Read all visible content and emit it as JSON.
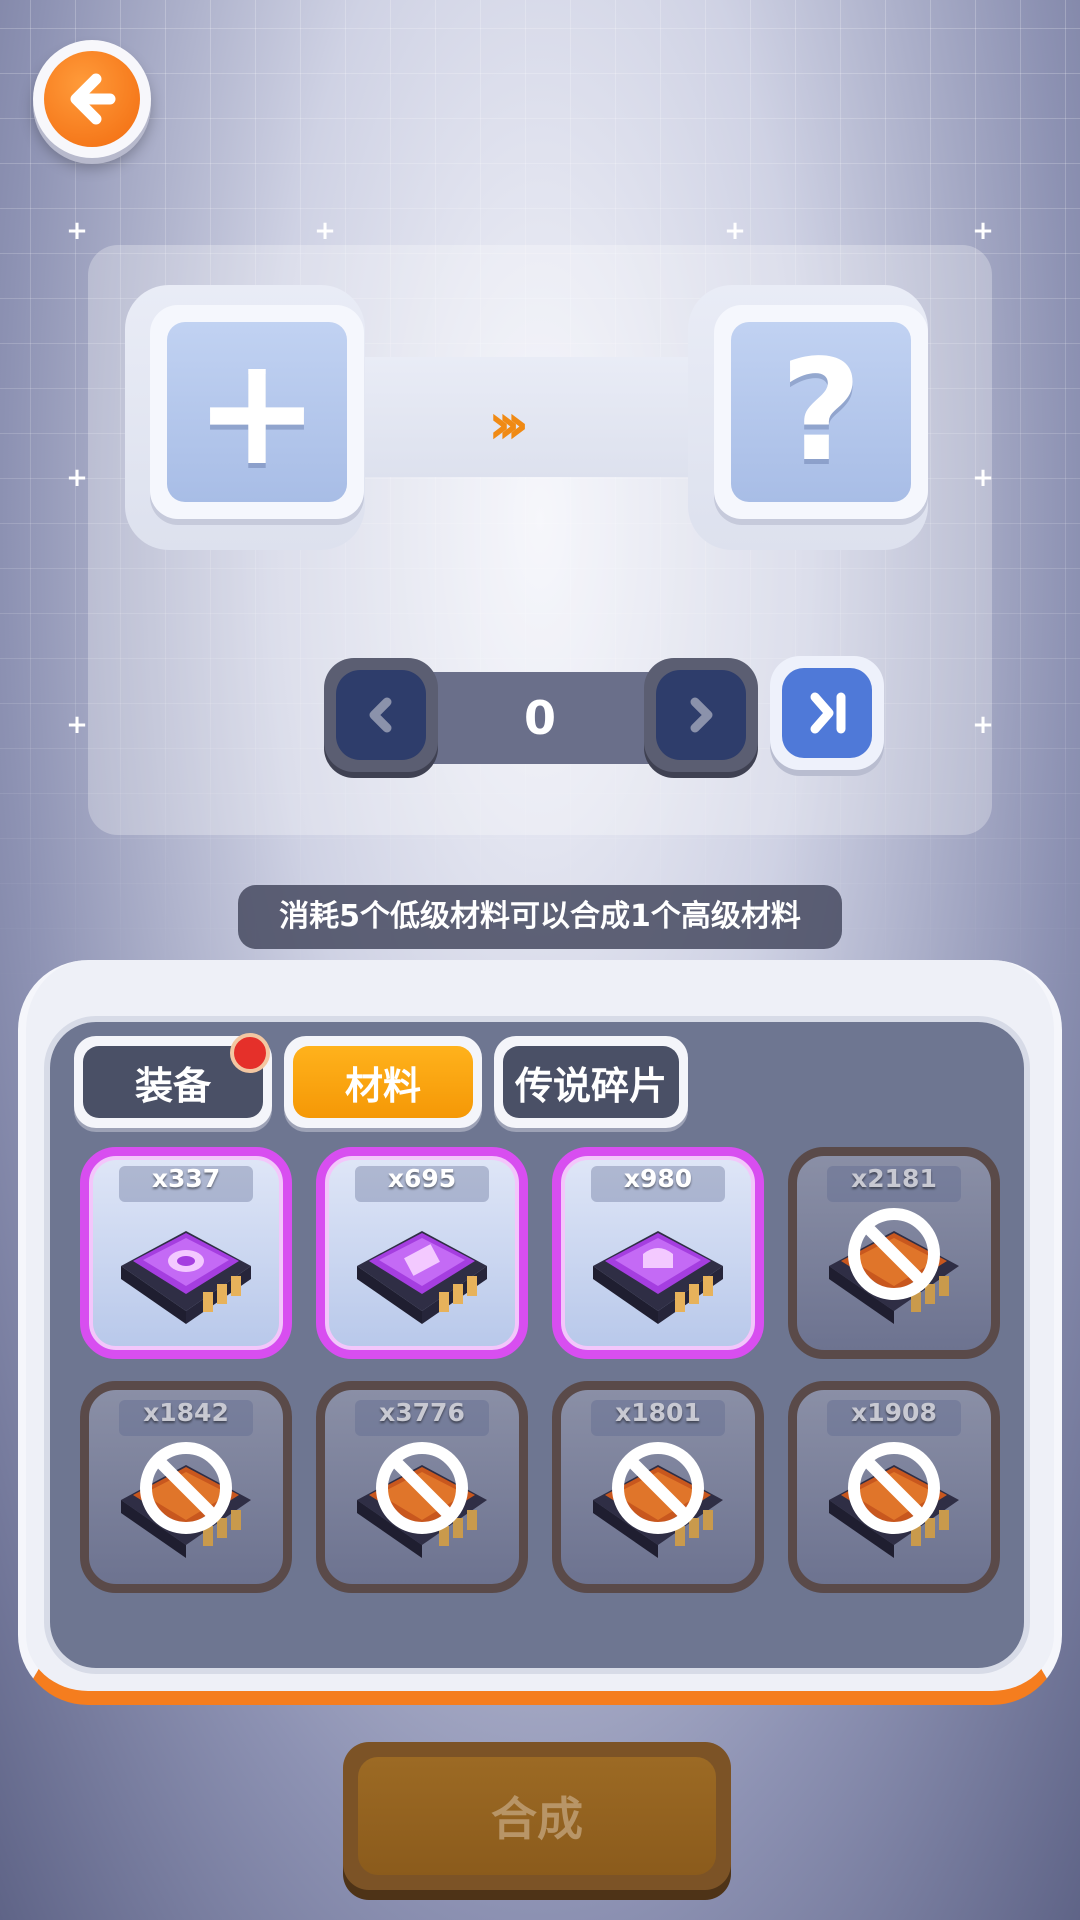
{
  "header": {
    "back_icon": "arrow-left-icon"
  },
  "synthesis": {
    "input_slot_icon": "plus-icon",
    "output_slot_icon": "question-icon",
    "input_symbol": "+",
    "output_symbol": "?",
    "arrow_text": "›››"
  },
  "stepper": {
    "value": "0"
  },
  "hint": "消耗5个低级材料可以合成1个高级材料",
  "tabs": [
    {
      "label": "装备",
      "active": false,
      "has_notification": true
    },
    {
      "label": "材料",
      "active": true,
      "has_notification": false
    },
    {
      "label": "传说碎片",
      "active": false,
      "has_notification": false
    }
  ],
  "items": [
    {
      "qty": "x337",
      "rarity": "purple",
      "locked": false
    },
    {
      "qty": "x695",
      "rarity": "purple",
      "locked": false
    },
    {
      "qty": "x980",
      "rarity": "purple",
      "locked": false
    },
    {
      "qty": "x2181",
      "rarity": "orange",
      "locked": true
    },
    {
      "qty": "x1842",
      "rarity": "orange",
      "locked": true
    },
    {
      "qty": "x3776",
      "rarity": "orange",
      "locked": true
    },
    {
      "qty": "x1801",
      "rarity": "orange",
      "locked": true
    },
    {
      "qty": "x1908",
      "rarity": "orange",
      "locked": true
    }
  ],
  "craft_button": {
    "label": "合成"
  },
  "colors": {
    "accent": "#f57d1e",
    "purple_frame": "#d84ef0",
    "tab_active": "#ffa414"
  }
}
